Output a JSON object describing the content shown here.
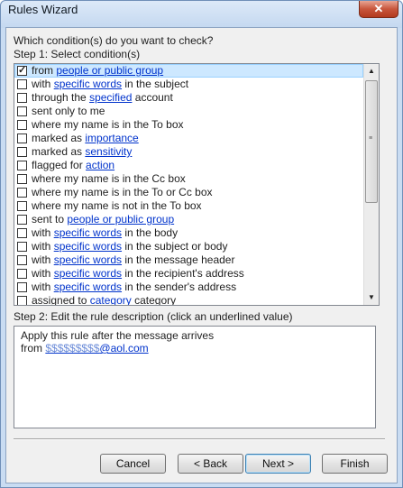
{
  "window": {
    "title": "Rules Wizard",
    "close_glyph": "✕"
  },
  "prompt": "Which condition(s) do you want to check?",
  "step1_label": "Step 1: Select condition(s)",
  "conditions": [
    {
      "checked": true,
      "selected": true,
      "parts": [
        {
          "t": "from "
        },
        {
          "t": "people or public group",
          "link": true
        }
      ]
    },
    {
      "checked": false,
      "parts": [
        {
          "t": "with "
        },
        {
          "t": "specific words",
          "link": true
        },
        {
          "t": " in the subject"
        }
      ]
    },
    {
      "checked": false,
      "parts": [
        {
          "t": "through the "
        },
        {
          "t": "specified",
          "link": true
        },
        {
          "t": " account"
        }
      ]
    },
    {
      "checked": false,
      "parts": [
        {
          "t": "sent only to me"
        }
      ]
    },
    {
      "checked": false,
      "parts": [
        {
          "t": "where my name is in the To box"
        }
      ]
    },
    {
      "checked": false,
      "parts": [
        {
          "t": "marked as "
        },
        {
          "t": "importance",
          "link": true
        }
      ]
    },
    {
      "checked": false,
      "parts": [
        {
          "t": "marked as "
        },
        {
          "t": "sensitivity",
          "link": true
        }
      ]
    },
    {
      "checked": false,
      "parts": [
        {
          "t": "flagged for "
        },
        {
          "t": "action",
          "link": true
        }
      ]
    },
    {
      "checked": false,
      "parts": [
        {
          "t": "where my name is in the Cc box"
        }
      ]
    },
    {
      "checked": false,
      "parts": [
        {
          "t": "where my name is in the To or Cc box"
        }
      ]
    },
    {
      "checked": false,
      "parts": [
        {
          "t": "where my name is not in the To box"
        }
      ]
    },
    {
      "checked": false,
      "parts": [
        {
          "t": "sent to "
        },
        {
          "t": "people or public group",
          "link": true
        }
      ]
    },
    {
      "checked": false,
      "parts": [
        {
          "t": "with "
        },
        {
          "t": "specific words",
          "link": true
        },
        {
          "t": " in the body"
        }
      ]
    },
    {
      "checked": false,
      "parts": [
        {
          "t": "with "
        },
        {
          "t": "specific words",
          "link": true
        },
        {
          "t": " in the subject or body"
        }
      ]
    },
    {
      "checked": false,
      "parts": [
        {
          "t": "with "
        },
        {
          "t": "specific words",
          "link": true
        },
        {
          "t": " in the message header"
        }
      ]
    },
    {
      "checked": false,
      "parts": [
        {
          "t": "with "
        },
        {
          "t": "specific words",
          "link": true
        },
        {
          "t": " in the recipient's address"
        }
      ]
    },
    {
      "checked": false,
      "parts": [
        {
          "t": "with "
        },
        {
          "t": "specific words",
          "link": true
        },
        {
          "t": " in the sender's address"
        }
      ]
    },
    {
      "checked": false,
      "parts": [
        {
          "t": "assigned to "
        },
        {
          "t": "category",
          "link": true
        },
        {
          "t": " category"
        }
      ]
    }
  ],
  "check_glyph": "✓",
  "scrollbar": {
    "up_glyph": "▲",
    "down_glyph": "▼",
    "grip_glyph": "≡"
  },
  "step2_label": "Step 2: Edit the rule description (click an underlined value)",
  "description": {
    "line1": "Apply this rule after the message arrives",
    "from_prefix": "from ",
    "address_obscured": "$$$$$$$$$",
    "address_suffix": "@aol.com"
  },
  "buttons": {
    "cancel": "Cancel",
    "back": "< Back",
    "next": "Next >",
    "finish": "Finish"
  }
}
